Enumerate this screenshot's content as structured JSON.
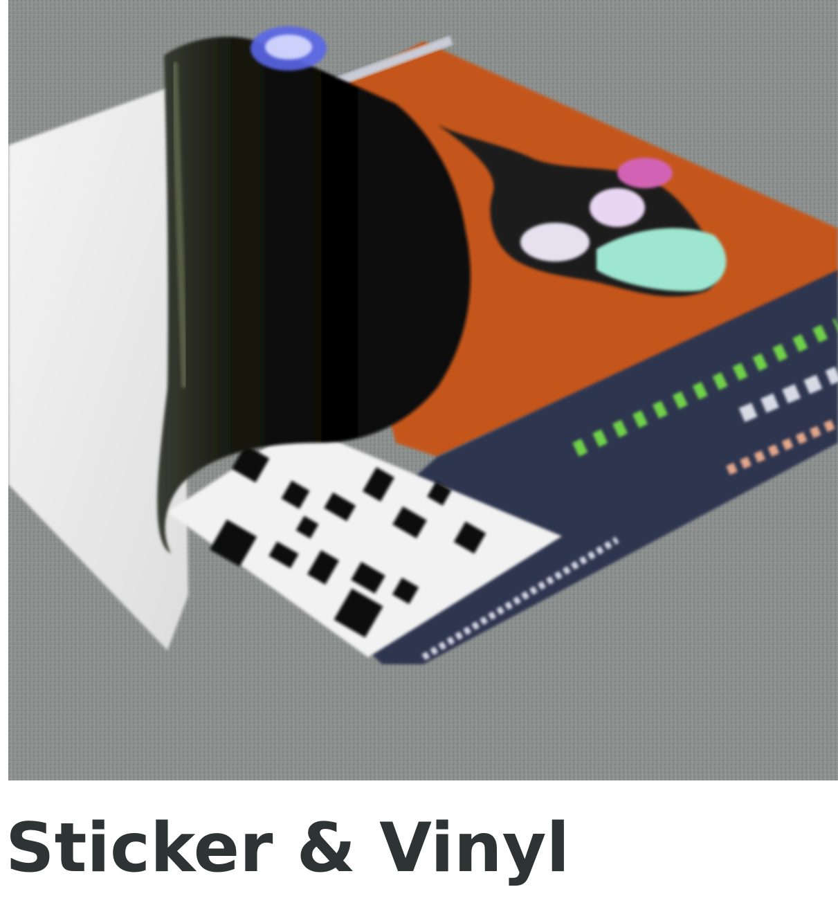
{
  "product_card": {
    "title": "Sticker & Vinyl",
    "image_subject": "sticker-peeling-from-carpet-floor"
  },
  "colors": {
    "title_text": "#2e3334",
    "carpet": "#8a8f8d",
    "sticker_orange": "#c4561e",
    "sticker_navy": "#2f3650",
    "backing_paper": "#eeeeee"
  }
}
